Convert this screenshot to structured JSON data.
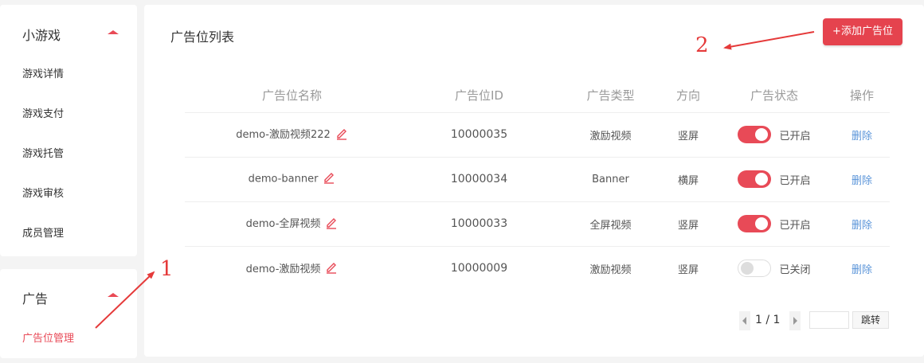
{
  "sidebar": {
    "sections": [
      {
        "title": "小游戏",
        "items": [
          "游戏详情",
          "游戏支付",
          "游戏托管",
          "游戏审核",
          "成员管理"
        ]
      },
      {
        "title": "广告",
        "items": [
          "广告位管理"
        ]
      }
    ]
  },
  "main": {
    "title": "广告位列表",
    "add_button_label": "+添加广告位",
    "columns": [
      "广告位名称",
      "广告位ID",
      "广告类型",
      "方向",
      "广告状态",
      "操作"
    ],
    "rows": [
      {
        "name": "demo-激励视频222",
        "id": "10000035",
        "type": "激励视频",
        "orientation": "竖屏",
        "enabled": true,
        "status": "已开启",
        "action": "删除"
      },
      {
        "name": "demo-banner",
        "id": "10000034",
        "type": "Banner",
        "orientation": "横屏",
        "enabled": true,
        "status": "已开启",
        "action": "删除"
      },
      {
        "name": "demo-全屏视频",
        "id": "10000033",
        "type": "全屏视频",
        "orientation": "竖屏",
        "enabled": true,
        "status": "已开启",
        "action": "删除"
      },
      {
        "name": "demo-激励视频",
        "id": "10000009",
        "type": "激励视频",
        "orientation": "竖屏",
        "enabled": false,
        "status": "已关闭",
        "action": "删除"
      }
    ],
    "pagination": {
      "info": "1 / 1",
      "jump_label": "跳转"
    }
  },
  "annotations": {
    "label_1": "1",
    "label_2": "2"
  },
  "colors": {
    "accent": "#e5434e",
    "link": "#5b95d9",
    "annotation": "#e53a3a"
  }
}
